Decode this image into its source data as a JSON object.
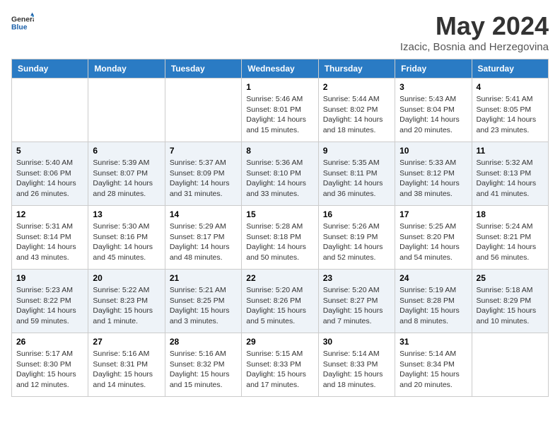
{
  "logo": {
    "general": "General",
    "blue": "Blue"
  },
  "title": "May 2024",
  "location": "Izacic, Bosnia and Herzegovina",
  "headers": [
    "Sunday",
    "Monday",
    "Tuesday",
    "Wednesday",
    "Thursday",
    "Friday",
    "Saturday"
  ],
  "weeks": [
    [
      {
        "day": "",
        "info": ""
      },
      {
        "day": "",
        "info": ""
      },
      {
        "day": "",
        "info": ""
      },
      {
        "day": "1",
        "info": "Sunrise: 5:46 AM\nSunset: 8:01 PM\nDaylight: 14 hours and 15 minutes."
      },
      {
        "day": "2",
        "info": "Sunrise: 5:44 AM\nSunset: 8:02 PM\nDaylight: 14 hours and 18 minutes."
      },
      {
        "day": "3",
        "info": "Sunrise: 5:43 AM\nSunset: 8:04 PM\nDaylight: 14 hours and 20 minutes."
      },
      {
        "day": "4",
        "info": "Sunrise: 5:41 AM\nSunset: 8:05 PM\nDaylight: 14 hours and 23 minutes."
      }
    ],
    [
      {
        "day": "5",
        "info": "Sunrise: 5:40 AM\nSunset: 8:06 PM\nDaylight: 14 hours and 26 minutes."
      },
      {
        "day": "6",
        "info": "Sunrise: 5:39 AM\nSunset: 8:07 PM\nDaylight: 14 hours and 28 minutes."
      },
      {
        "day": "7",
        "info": "Sunrise: 5:37 AM\nSunset: 8:09 PM\nDaylight: 14 hours and 31 minutes."
      },
      {
        "day": "8",
        "info": "Sunrise: 5:36 AM\nSunset: 8:10 PM\nDaylight: 14 hours and 33 minutes."
      },
      {
        "day": "9",
        "info": "Sunrise: 5:35 AM\nSunset: 8:11 PM\nDaylight: 14 hours and 36 minutes."
      },
      {
        "day": "10",
        "info": "Sunrise: 5:33 AM\nSunset: 8:12 PM\nDaylight: 14 hours and 38 minutes."
      },
      {
        "day": "11",
        "info": "Sunrise: 5:32 AM\nSunset: 8:13 PM\nDaylight: 14 hours and 41 minutes."
      }
    ],
    [
      {
        "day": "12",
        "info": "Sunrise: 5:31 AM\nSunset: 8:14 PM\nDaylight: 14 hours and 43 minutes."
      },
      {
        "day": "13",
        "info": "Sunrise: 5:30 AM\nSunset: 8:16 PM\nDaylight: 14 hours and 45 minutes."
      },
      {
        "day": "14",
        "info": "Sunrise: 5:29 AM\nSunset: 8:17 PM\nDaylight: 14 hours and 48 minutes."
      },
      {
        "day": "15",
        "info": "Sunrise: 5:28 AM\nSunset: 8:18 PM\nDaylight: 14 hours and 50 minutes."
      },
      {
        "day": "16",
        "info": "Sunrise: 5:26 AM\nSunset: 8:19 PM\nDaylight: 14 hours and 52 minutes."
      },
      {
        "day": "17",
        "info": "Sunrise: 5:25 AM\nSunset: 8:20 PM\nDaylight: 14 hours and 54 minutes."
      },
      {
        "day": "18",
        "info": "Sunrise: 5:24 AM\nSunset: 8:21 PM\nDaylight: 14 hours and 56 minutes."
      }
    ],
    [
      {
        "day": "19",
        "info": "Sunrise: 5:23 AM\nSunset: 8:22 PM\nDaylight: 14 hours and 59 minutes."
      },
      {
        "day": "20",
        "info": "Sunrise: 5:22 AM\nSunset: 8:23 PM\nDaylight: 15 hours and 1 minute."
      },
      {
        "day": "21",
        "info": "Sunrise: 5:21 AM\nSunset: 8:25 PM\nDaylight: 15 hours and 3 minutes."
      },
      {
        "day": "22",
        "info": "Sunrise: 5:20 AM\nSunset: 8:26 PM\nDaylight: 15 hours and 5 minutes."
      },
      {
        "day": "23",
        "info": "Sunrise: 5:20 AM\nSunset: 8:27 PM\nDaylight: 15 hours and 7 minutes."
      },
      {
        "day": "24",
        "info": "Sunrise: 5:19 AM\nSunset: 8:28 PM\nDaylight: 15 hours and 8 minutes."
      },
      {
        "day": "25",
        "info": "Sunrise: 5:18 AM\nSunset: 8:29 PM\nDaylight: 15 hours and 10 minutes."
      }
    ],
    [
      {
        "day": "26",
        "info": "Sunrise: 5:17 AM\nSunset: 8:30 PM\nDaylight: 15 hours and 12 minutes."
      },
      {
        "day": "27",
        "info": "Sunrise: 5:16 AM\nSunset: 8:31 PM\nDaylight: 15 hours and 14 minutes."
      },
      {
        "day": "28",
        "info": "Sunrise: 5:16 AM\nSunset: 8:32 PM\nDaylight: 15 hours and 15 minutes."
      },
      {
        "day": "29",
        "info": "Sunrise: 5:15 AM\nSunset: 8:33 PM\nDaylight: 15 hours and 17 minutes."
      },
      {
        "day": "30",
        "info": "Sunrise: 5:14 AM\nSunset: 8:33 PM\nDaylight: 15 hours and 18 minutes."
      },
      {
        "day": "31",
        "info": "Sunrise: 5:14 AM\nSunset: 8:34 PM\nDaylight: 15 hours and 20 minutes."
      },
      {
        "day": "",
        "info": ""
      }
    ]
  ]
}
